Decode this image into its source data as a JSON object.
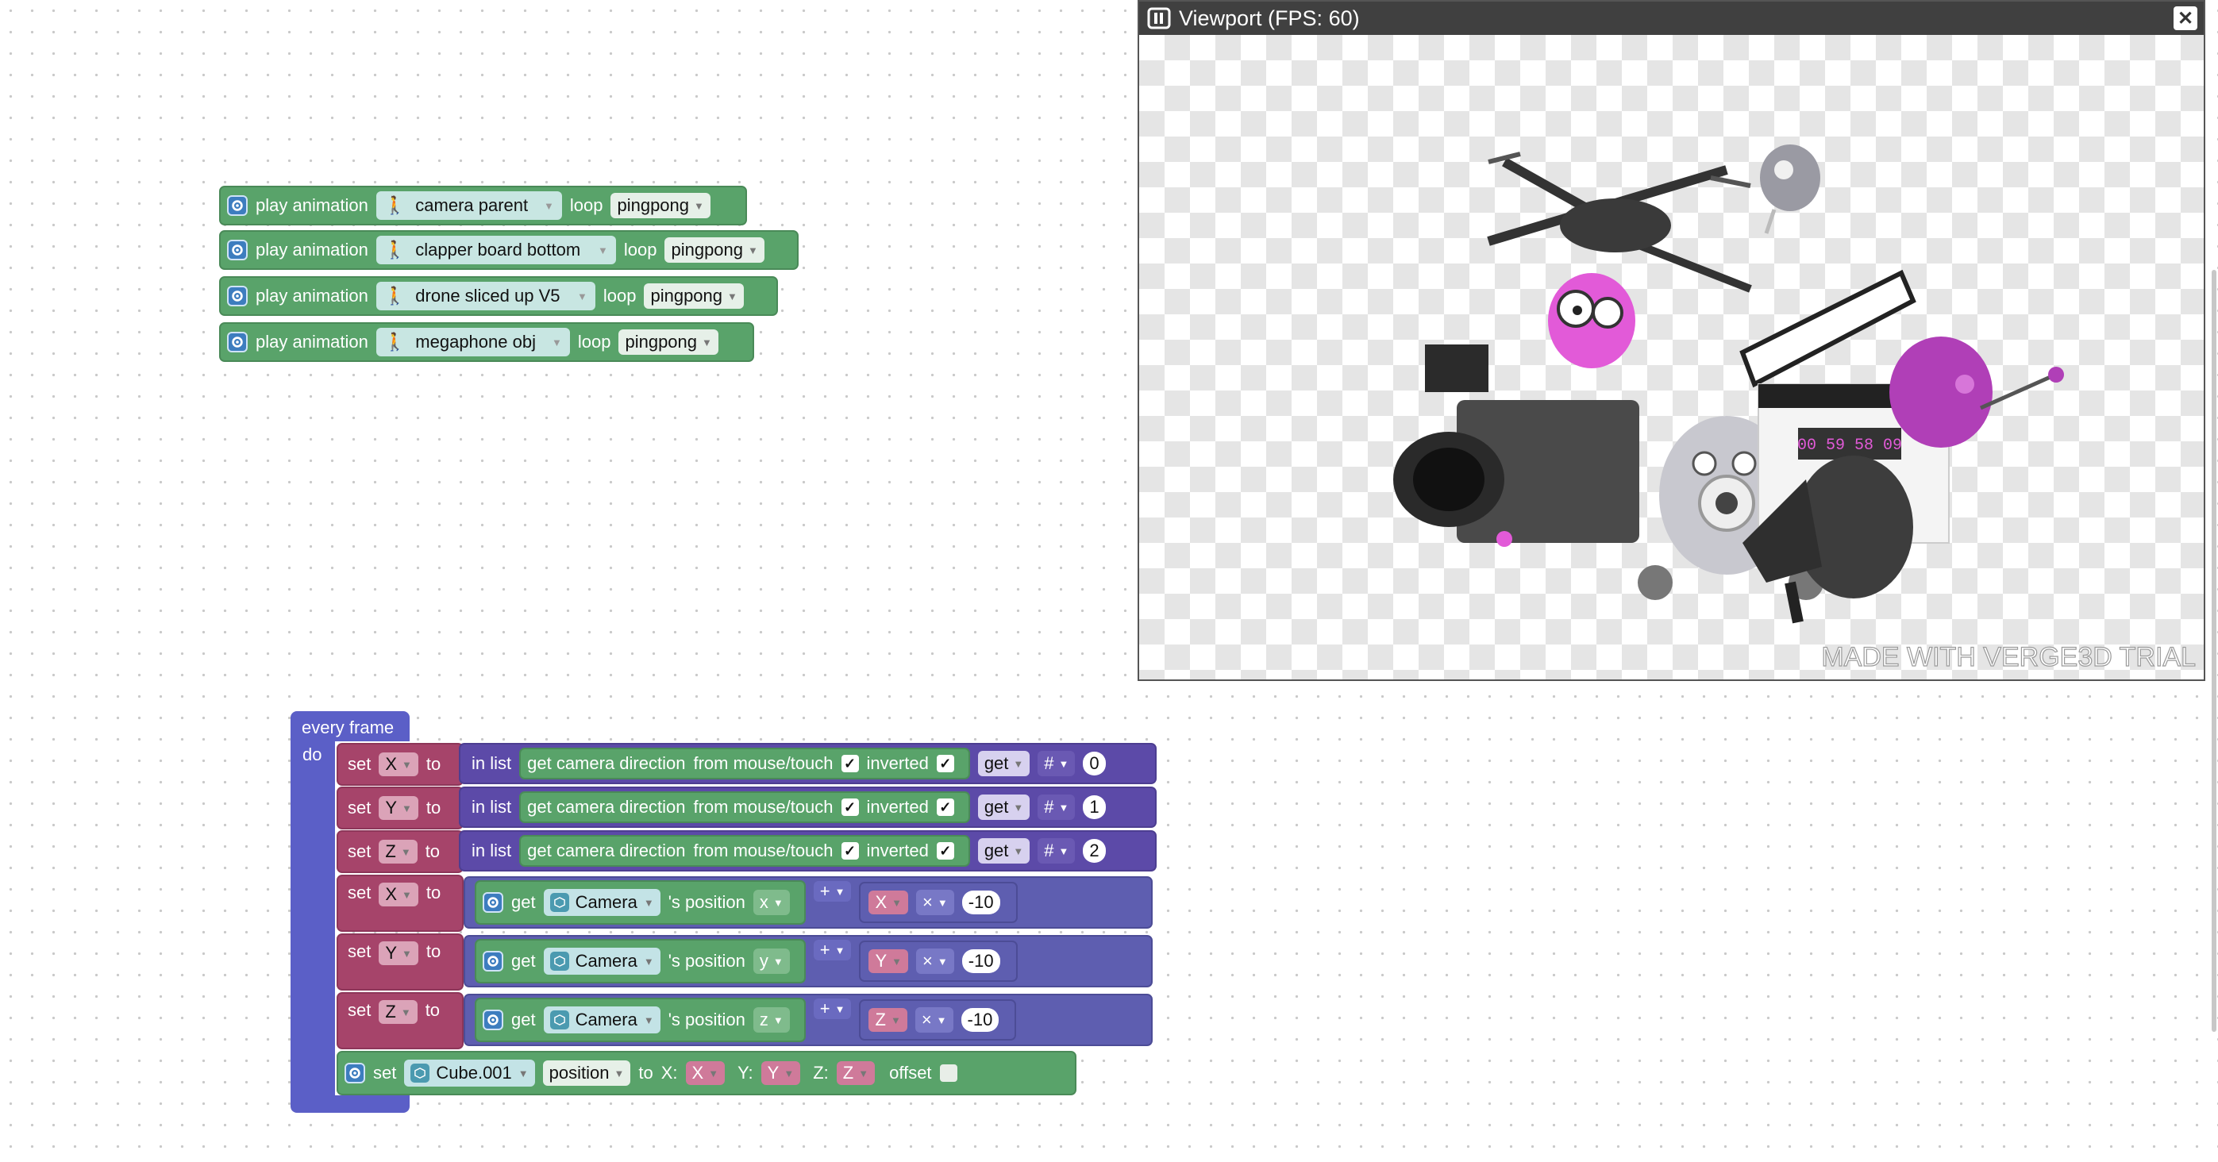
{
  "viewport": {
    "title": "Viewport (FPS: 60)",
    "watermark": "MADE WITH VERGE3D TRIAL",
    "clapper_timecode": "00 59 58 09"
  },
  "play_blocks": [
    {
      "label": "play animation",
      "object": "camera parent",
      "loop_label": "loop",
      "loop": "pingpong"
    },
    {
      "label": "play animation",
      "object": "clapper board bottom",
      "loop_label": "loop",
      "loop": "pingpong"
    },
    {
      "label": "play animation",
      "object": "drone sliced up V5",
      "loop_label": "loop",
      "loop": "pingpong"
    },
    {
      "label": "play animation",
      "object": "megaphone obj",
      "loop_label": "loop",
      "loop": "pingpong"
    }
  ],
  "every_frame": {
    "header": "every frame",
    "do": "do",
    "set_list_rows": [
      {
        "set": "set",
        "var": "X",
        "to": "to",
        "in_list": "in list",
        "getcam": "get camera direction",
        "from": "from mouse/touch",
        "check1": "✓",
        "inverted": "inverted",
        "check2": "✓",
        "get": "get",
        "hash": "#",
        "index": "0"
      },
      {
        "set": "set",
        "var": "Y",
        "to": "to",
        "in_list": "in list",
        "getcam": "get camera direction",
        "from": "from mouse/touch",
        "check1": "✓",
        "inverted": "inverted",
        "check2": "✓",
        "get": "get",
        "hash": "#",
        "index": "1"
      },
      {
        "set": "set",
        "var": "Z",
        "to": "to",
        "in_list": "in list",
        "getcam": "get camera direction",
        "from": "from mouse/touch",
        "check1": "✓",
        "inverted": "inverted",
        "check2": "✓",
        "get": "get",
        "hash": "#",
        "index": "2"
      }
    ],
    "set_math_rows": [
      {
        "set": "set",
        "var": "X",
        "to": "to",
        "get": "get",
        "object": "Camera",
        "pos": "'s position",
        "axis": "x",
        "op": "+",
        "mvar": "X",
        "times": "×",
        "value": "-10"
      },
      {
        "set": "set",
        "var": "Y",
        "to": "to",
        "get": "get",
        "object": "Camera",
        "pos": "'s position",
        "axis": "y",
        "op": "+",
        "mvar": "Y",
        "times": "×",
        "value": "-10"
      },
      {
        "set": "set",
        "var": "Z",
        "to": "to",
        "get": "get",
        "object": "Camera",
        "pos": "'s position",
        "axis": "z",
        "op": "+",
        "mvar": "Z",
        "times": "×",
        "value": "-10"
      }
    ],
    "set_pos": {
      "set": "set",
      "object": "Cube.001",
      "prop": "position",
      "to": "to",
      "x_label": "X:",
      "x": "X",
      "y_label": "Y:",
      "y": "Y",
      "z_label": "Z:",
      "z": "Z",
      "offset": "offset"
    }
  },
  "colors": {
    "green": "#59a36a",
    "purple": "#5c4aa8",
    "indigo": "#5e5eb0",
    "maroon": "#a6446a",
    "event": "#5b5fc7",
    "gear": "#3d7dbf",
    "viewport_bar": "#404040"
  },
  "icons": [
    "gear-icon",
    "walk-icon",
    "cube-icon",
    "dropdown-caret-icon",
    "checkbox-icon",
    "close-icon",
    "panel-toggle-icon"
  ]
}
